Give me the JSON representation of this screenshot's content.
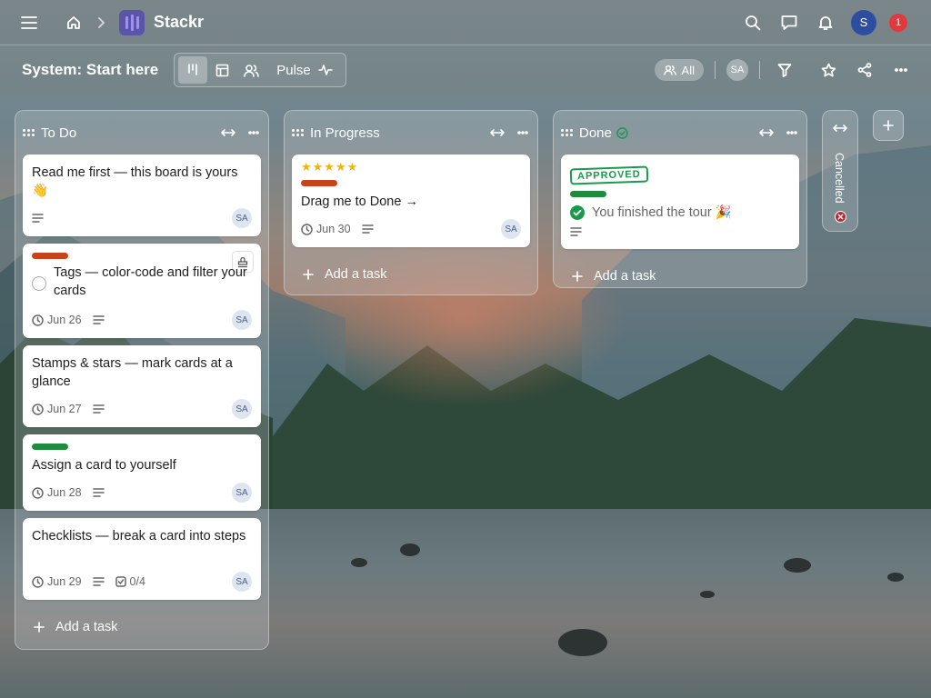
{
  "app": {
    "brand": "Stackr"
  },
  "header": {
    "notification_count": "1",
    "user_initial": "S"
  },
  "board": {
    "title": "System: Start here",
    "pulse_label": "Pulse",
    "filter_all": "All",
    "member_initials": "SA"
  },
  "columns": {
    "todo": {
      "title": "To Do",
      "add_task": "Add a task",
      "cards": [
        {
          "title": "Read me first — this board is yours",
          "emoji": "👋",
          "assignee": "SA"
        },
        {
          "tag_color": "#c8431b",
          "title": "Tags — color-code and filter your cards",
          "date": "Jun 26",
          "assignee": "SA"
        },
        {
          "title": "Stamps & stars — mark cards at a glance",
          "date": "Jun 27",
          "assignee": "SA"
        },
        {
          "tag_color": "#1f8b3c",
          "title": "Assign a card to yourself",
          "date": "Jun 28",
          "assignee": "SA"
        },
        {
          "title": "Checklists — break a card into steps",
          "date": "Jun 29",
          "checklist": "0/4",
          "assignee": "SA"
        }
      ]
    },
    "in_progress": {
      "title": "In Progress",
      "add_task": "Add a task",
      "cards": [
        {
          "stars": "★★★★★",
          "tag_color": "#c8431b",
          "title": "Drag me to Done →",
          "date": "Jun 30",
          "assignee": "SA"
        }
      ]
    },
    "done": {
      "title": "Done",
      "add_task": "Add a task",
      "cards": [
        {
          "stamp": "APPROVED",
          "tag_color": "#1f8b3c",
          "title": "You finished the tour 🎉"
        }
      ]
    },
    "cancelled": {
      "title": "Cancelled"
    }
  },
  "colors": {
    "accent": "#5b55a8",
    "notification": "#e0393e",
    "avatar": "#2d4ea0",
    "done_green": "#1a9a4a",
    "cancel_red": "#c0262d"
  }
}
